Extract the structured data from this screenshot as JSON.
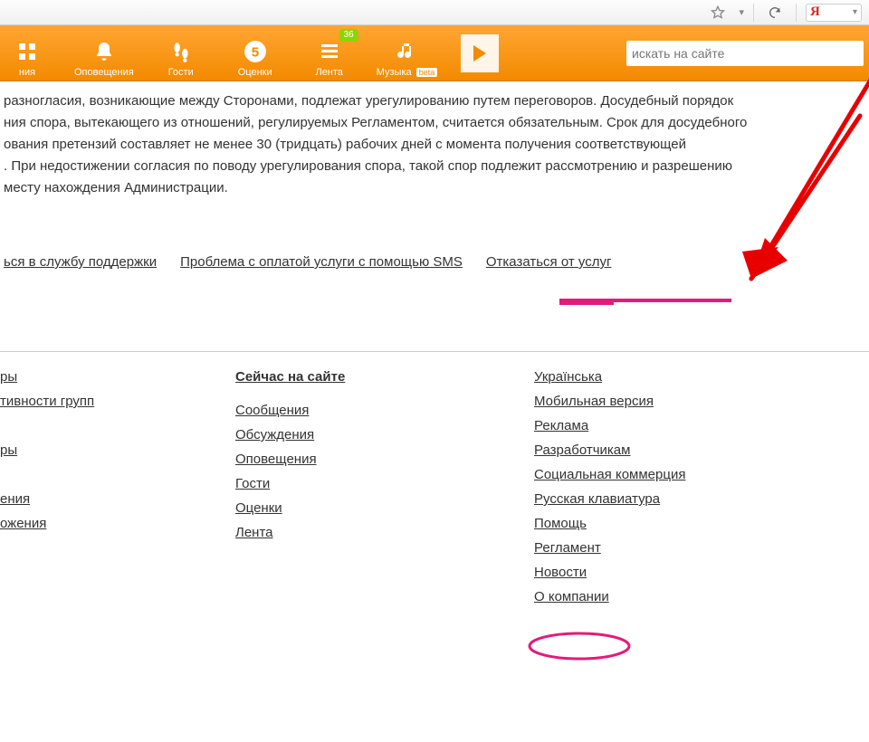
{
  "browser": {
    "star_icon": "star-icon",
    "reload_icon": "reload-icon",
    "ya_letter": "Я"
  },
  "nav": {
    "items": [
      {
        "label": "ния",
        "icon": "grid-icon"
      },
      {
        "label": "Оповещения",
        "icon": "bell-icon"
      },
      {
        "label": "Гости",
        "icon": "footsteps-icon"
      },
      {
        "label": "Оценки",
        "icon": "five-icon"
      },
      {
        "label": "Лента",
        "icon": "feed-icon",
        "badge": "36"
      },
      {
        "label": "Музыка",
        "icon": "music-icon",
        "beta": "beta"
      }
    ],
    "search_placeholder": "искать на сайте"
  },
  "body_text": "разногласия, возникающие между Сторонами, подлежат урегулированию путем переговоров. Досудебный порядок\nния спора, вытекающего из отношений, регулируемых Регламентом, считается обязательным. Срок для досудебного\nования претензий составляет не менее 30 (тридцать) рабочих дней с момента получения соответствующей\n. При недостижении согласия по поводу урегулирования спора, такой спор подлежит рассмотрению и разрешению\nместу нахождения Администрации.",
  "support_links": {
    "contact": "ься в службу поддержки",
    "sms": "Проблема с оплатой услуги с помощью SMS",
    "cancel": "Отказаться от услуг"
  },
  "footer": {
    "colA": {
      "links": [
        "ры",
        "тивности групп",
        "",
        "ры",
        "",
        "ения",
        "ожения"
      ]
    },
    "colB": {
      "heading": "Сейчас на сайте",
      "links": [
        "Сообщения",
        "Обсуждения",
        "Оповещения",
        "Гости",
        "Оценки",
        "Лента"
      ]
    },
    "colC": {
      "links": [
        "Українська",
        "Мобильная версия",
        "Реклама",
        "Разработчикам",
        "Социальная коммерция",
        "Русская клавиатура",
        "Помощь",
        "Регламент",
        "Новости",
        "О компании"
      ]
    }
  }
}
